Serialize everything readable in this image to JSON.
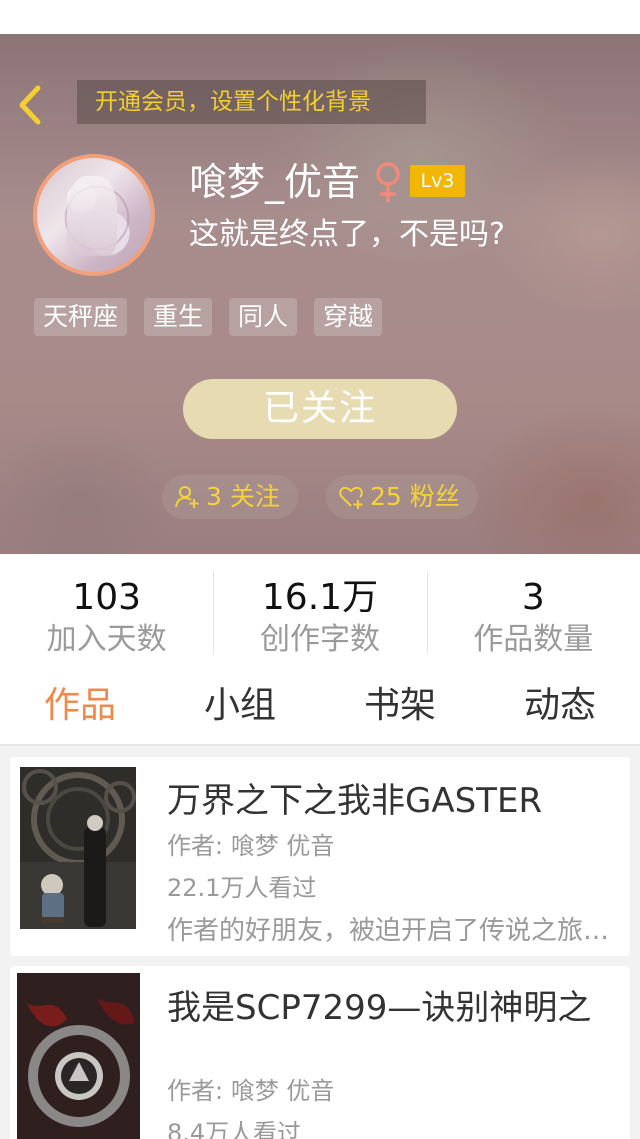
{
  "header": {
    "vip_banner": "开通会员，设置个性化背景",
    "back_icon": "chevron-left-icon",
    "user": {
      "name": "喰梦_优音",
      "gender_icon": "female-icon",
      "level": "Lv3",
      "signature": "这就是终点了，不是吗?"
    },
    "tags": [
      "天秤座",
      "重生",
      "同人",
      "穿越"
    ],
    "follow_button": "已关注",
    "following": {
      "icon": "user-add-icon",
      "text": "3 关注"
    },
    "fans": {
      "icon": "heart-add-icon",
      "text": "25 粉丝"
    }
  },
  "stats": [
    {
      "value": "103",
      "label": "加入天数"
    },
    {
      "value": "16.1万",
      "label": "创作字数"
    },
    {
      "value": "3",
      "label": "作品数量"
    }
  ],
  "tabs": [
    {
      "label": "作品",
      "active": true
    },
    {
      "label": "小组",
      "active": false
    },
    {
      "label": "书架",
      "active": false
    },
    {
      "label": "动态",
      "active": false
    }
  ],
  "books": [
    {
      "title": "万界之下之我非GASTER",
      "author": "作者: 喰梦  优音",
      "readers": "22.1万人看过",
      "description": "作者的好朋友，被迫开启了传说之旅……"
    },
    {
      "title": "我是SCP7299—诀别神明之",
      "author": "作者: 喰梦  优音",
      "readers": "8.4万人看过",
      "description": ""
    }
  ],
  "colors": {
    "accent": "#f08a4b",
    "gold": "#f3cf2f",
    "level_badge": "#f2b705",
    "follow_button": "#e7dbb2"
  }
}
